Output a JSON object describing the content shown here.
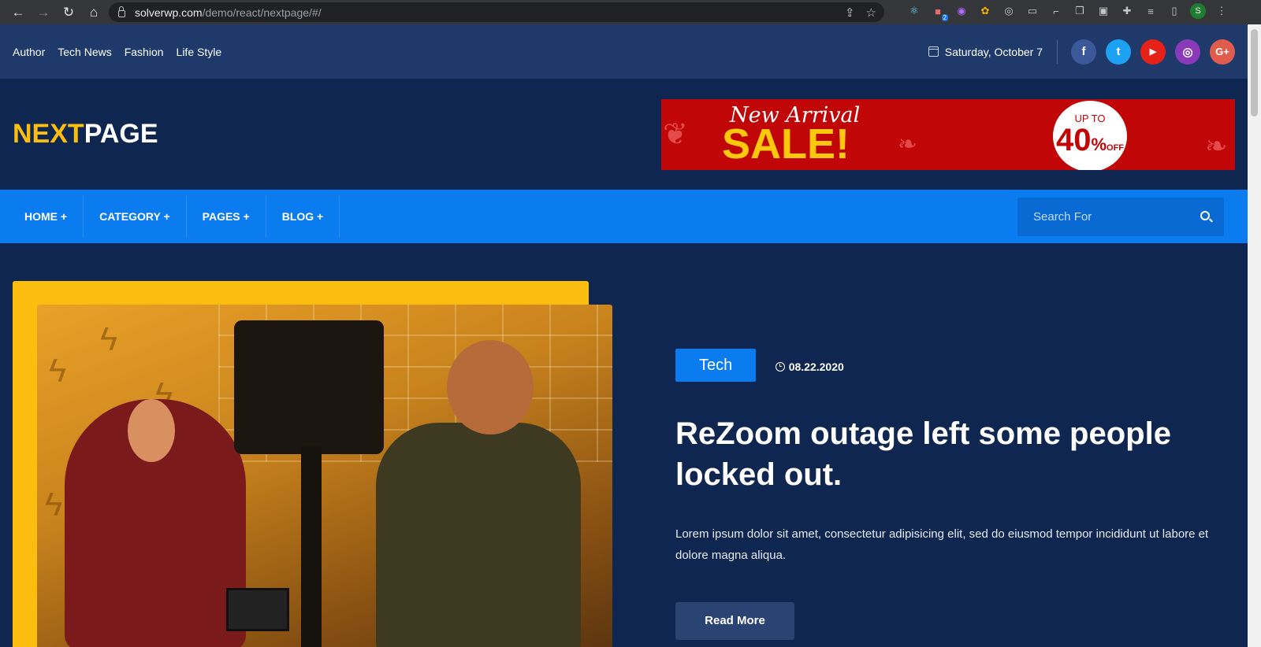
{
  "browser": {
    "url_host": "solverwp.com",
    "url_path": "/demo/react/nextpage/#/",
    "profile_initial": "S",
    "extension_badge": "2"
  },
  "topbar": {
    "links": [
      "Author",
      "Tech News",
      "Fashion",
      "Life Style"
    ],
    "date": "Saturday, October 7",
    "socials": [
      {
        "icon": "facebook-icon",
        "glyph": "f",
        "color": "#3b5998"
      },
      {
        "icon": "twitter-icon",
        "glyph": "t",
        "color": "#1da1f2"
      },
      {
        "icon": "youtube-icon",
        "glyph": "▶",
        "color": "#e62117"
      },
      {
        "icon": "instagram-icon",
        "glyph": "◎",
        "color": "#8a3ab9"
      },
      {
        "icon": "google-plus-icon",
        "glyph": "G+",
        "color": "#e05d4e"
      }
    ]
  },
  "brand": {
    "logo_part1": "NEXT",
    "logo_part2": "PAGE"
  },
  "ad": {
    "line1": "New Arrival",
    "line2": "SALE!",
    "badge_top": "UP TO",
    "badge_value": "40",
    "badge_pct": "%",
    "badge_off": "OFF"
  },
  "nav": {
    "items": [
      "HOME +",
      "CATEGORY +",
      "PAGES +",
      "BLOG +"
    ],
    "search_placeholder": "Search For"
  },
  "hero": {
    "tag": "Tech",
    "date": "08.22.2020",
    "title": "ReZoom outage left some people locked out.",
    "description": "Lorem ipsum dolor sit amet, consectetur adipisicing elit, sed do eiusmod tempor incididunt ut labore et dolore magna aliqua.",
    "button": "Read More"
  },
  "colors": {
    "accent_yellow": "#fbbe0e",
    "accent_blue": "#0b7bf0",
    "background": "#0f2650"
  }
}
